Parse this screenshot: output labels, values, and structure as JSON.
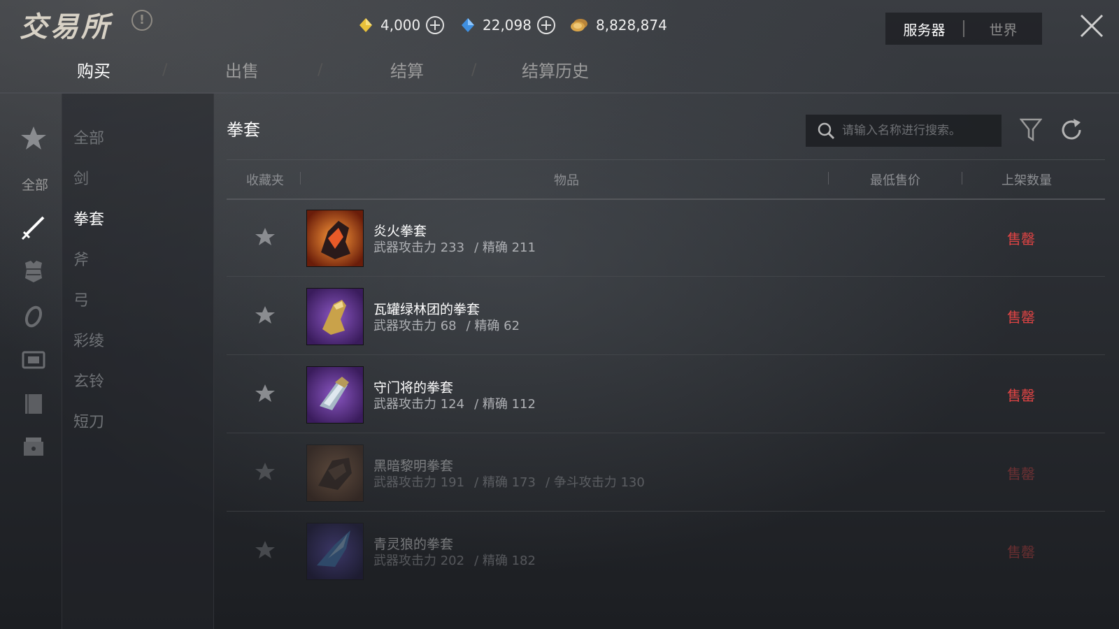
{
  "app": {
    "title": "交易所",
    "info_icon": "info-icon"
  },
  "currencies": [
    {
      "icon": "gold-gem-icon",
      "amount": "4,000",
      "color": "#e8c13a"
    },
    {
      "icon": "blue-gem-icon",
      "amount": "22,098",
      "color": "#3f8fe0"
    },
    {
      "icon": "coin-icon",
      "amount": "8,828,874",
      "color": "#d9a54a"
    }
  ],
  "server_switch": {
    "server": "服务器",
    "world": "世界",
    "active": "server"
  },
  "tabs": [
    {
      "label": "购买",
      "active": true
    },
    {
      "label": "出售",
      "active": false
    },
    {
      "label": "结算",
      "active": false
    },
    {
      "label": "结算历史",
      "active": false
    }
  ],
  "rail": {
    "items": [
      "star-icon",
      "sword-icon",
      "armor-icon",
      "ring-icon",
      "chest-icon",
      "book-icon",
      "box-icon"
    ],
    "all_label": "全部"
  },
  "categories": [
    {
      "label": "全部",
      "active": false
    },
    {
      "label": "剑",
      "active": false
    },
    {
      "label": "拳套",
      "active": true
    },
    {
      "label": "斧",
      "active": false
    },
    {
      "label": "弓",
      "active": false
    },
    {
      "label": "彩绫",
      "active": false
    },
    {
      "label": "玄铃",
      "active": false
    },
    {
      "label": "短刀",
      "active": false
    }
  ],
  "main": {
    "section_title": "拳套",
    "search": {
      "placeholder": "请输入名称进行搜索。",
      "value": ""
    },
    "columns": {
      "favorite": "收藏夹",
      "item": "物品",
      "lowest_price": "最低售价",
      "listed_count": "上架数量"
    }
  },
  "items": [
    {
      "name": "炎火拳套",
      "stats": [
        "武器攻击力 233",
        "/ 精确 211"
      ],
      "status": "售罄",
      "thumb": "fire-gauntlet-icon",
      "thumb_bg": "#c4501e",
      "faded": false
    },
    {
      "name": "瓦罐绿林团的拳套",
      "stats": [
        "武器攻击力 68",
        "/ 精确 62"
      ],
      "status": "售罄",
      "thumb": "gold-gauntlet-icon",
      "thumb_bg": "#5a2f86",
      "faded": false
    },
    {
      "name": "守门将的拳套",
      "stats": [
        "武器攻击力 124",
        "/ 精确 112"
      ],
      "status": "售罄",
      "thumb": "silver-gauntlet-icon",
      "thumb_bg": "#5a2f86",
      "faded": false
    },
    {
      "name": "黑暗黎明拳套",
      "stats": [
        "武器攻击力 191",
        "/ 精确 173",
        "/ 争斗攻击力 130"
      ],
      "status": "售罄",
      "thumb": "dark-gauntlet-icon",
      "thumb_bg": "#8a5a3a",
      "faded": true
    },
    {
      "name": "青灵狼的拳套",
      "stats": [
        "武器攻击力 202",
        "/ 精确 182"
      ],
      "status": "售罄",
      "thumb": "wolf-gauntlet-icon",
      "thumb_bg": "#3c2f7a",
      "faded": true
    }
  ]
}
